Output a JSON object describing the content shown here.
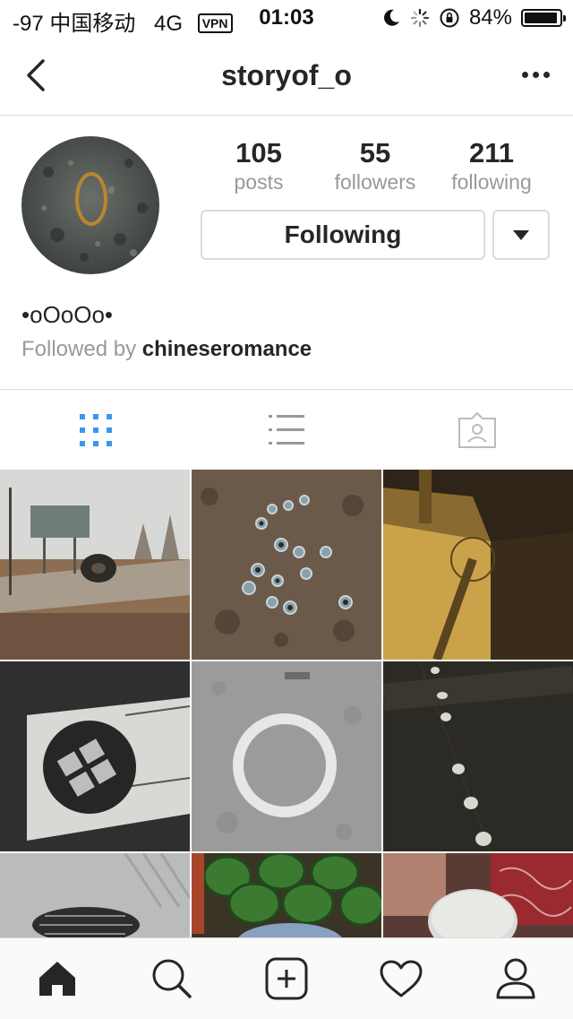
{
  "status_bar": {
    "carrier": "-97 中国移动",
    "network": "4G",
    "vpn": "VPN",
    "time": "01:03",
    "battery": "84%",
    "battery_level": 0.84
  },
  "header": {
    "username": "storyof_o",
    "back_icon": "chevron-left-icon",
    "more_icon": "more-options-icon"
  },
  "profile": {
    "stats": [
      {
        "value": "105",
        "label": "posts"
      },
      {
        "value": "55",
        "label": "followers"
      },
      {
        "value": "211",
        "label": "following"
      }
    ],
    "follow_button": "Following",
    "full_name": "•oOoOo•",
    "followed_by_prefix": "Followed by ",
    "followed_by_user": "chineseromance"
  },
  "view_tabs": [
    {
      "icon": "grid-icon",
      "active": true
    },
    {
      "icon": "list-icon",
      "active": false
    },
    {
      "icon": "tagged-icon",
      "active": false
    }
  ],
  "grid_posts": [
    "road-tire-photo",
    "bolts-on-ground-photo",
    "wall-shadow-photo",
    "drain-shadow-photo",
    "chalk-circle-photo",
    "dots-line-photo",
    "manhole-photo",
    "watermelons-photo",
    "cloth-stool-photo"
  ],
  "bottom_tabs": [
    {
      "icon": "home-icon",
      "active": true
    },
    {
      "icon": "search-icon",
      "active": false
    },
    {
      "icon": "new-post-icon",
      "active": false
    },
    {
      "icon": "activity-heart-icon",
      "active": false
    },
    {
      "icon": "profile-icon",
      "active": false
    }
  ],
  "colors": {
    "accent": "#3897f0",
    "border": "#dbdbdb",
    "text": "#262626",
    "secondary_text": "#999999"
  }
}
